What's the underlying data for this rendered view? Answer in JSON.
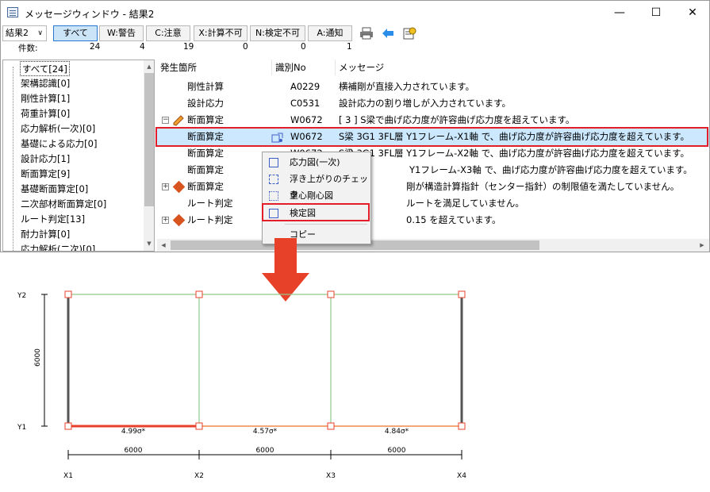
{
  "window": {
    "title": "メッセージウィンドウ - 結果2",
    "min_glyph": "—",
    "max_glyph": "☐",
    "close_glyph": "✕"
  },
  "toolbar": {
    "result_select": "結果2",
    "filters": [
      "すべて",
      "W:警告",
      "C:注意",
      "X:計算不可",
      "N:検定不可",
      "A:通知"
    ],
    "count_label": "件数:",
    "counts": [
      "24",
      "4",
      "19",
      "0",
      "0",
      "1"
    ]
  },
  "tree": {
    "items": [
      "すべて[24]",
      "架構認識[0]",
      "剛性計算[1]",
      "荷重計算[0]",
      "応力解析(一次)[0]",
      "基礎による応力[0]",
      "設計応力[1]",
      "断面算定[9]",
      "基礎断面算定[0]",
      "二次部材断面算定[0]",
      "ルート判定[13]",
      "耐力計算[0]",
      "応力解析(二次)[0]"
    ]
  },
  "list": {
    "headers": [
      "発生箇所",
      "識別No",
      "メッセージ"
    ],
    "rows": [
      {
        "loc": "剛性計算",
        "id": "A0229",
        "msg": "横補剛が直接入力されています。"
      },
      {
        "loc": "設計応力",
        "id": "C0531",
        "msg": "設計応力の割り増しが入力されています。"
      },
      {
        "loc": "断面算定",
        "id": "W0672",
        "msg": "[ 3 ] S梁で曲げ応力度が許容曲げ応力度を超えています。"
      },
      {
        "loc": "断面算定",
        "id": "W0672",
        "msg": "S梁 3G1  3FL層 Y1フレーム-X1軸 で、曲げ応力度が許容曲げ応力度を超えています。"
      },
      {
        "loc": "断面算定",
        "id": "W0672",
        "msg": "S梁 3G1  3FL層 Y1フレーム-X2軸 で、曲げ応力度が許容曲げ応力度を超えています。"
      },
      {
        "loc": "断面算定",
        "id": "",
        "msg": "Y1フレーム-X3軸 で、曲げ応力度が許容曲げ応力度を超えています。"
      },
      {
        "loc": "断面算定",
        "id": "",
        "msg": "剛が構造計算指針（センター指針）の制限値を満たしていません。"
      },
      {
        "loc": "ルート判定",
        "id": "",
        "msg": "ルートを満足していません。"
      },
      {
        "loc": "ルート判定",
        "id": "",
        "msg": "0.15 を超えています。"
      }
    ]
  },
  "context_menu": {
    "items": [
      "応力図(一次)",
      "浮き上がりのチェック",
      "重心剛心図",
      "検定図",
      "コピー"
    ]
  },
  "frame": {
    "y_labels": [
      "Y2",
      "Y1"
    ],
    "x_labels": [
      "X1",
      "X2",
      "X3",
      "X4"
    ],
    "height_dim": "6000",
    "span_dims": [
      "6000",
      "6000",
      "6000"
    ],
    "beam_values": [
      "4.99σ*",
      "4.57σ*",
      "4.84σ*"
    ],
    "colors": {
      "over": "#e8412a",
      "orange": "#f08a4b",
      "green": "#8fc98a"
    }
  }
}
